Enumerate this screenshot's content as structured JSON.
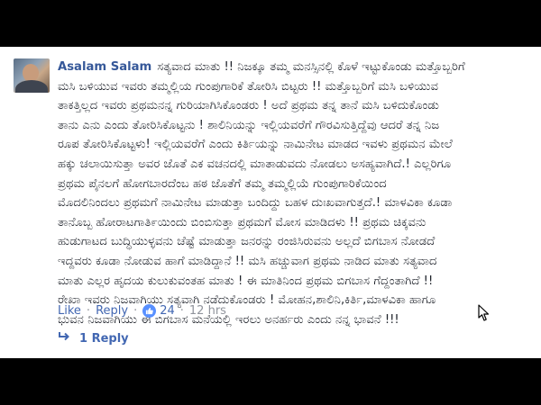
{
  "comment": {
    "author": "Asalam Salam",
    "text": "ಸತ್ಯವಾದ ಮಾತು !! ನಿಜಕ್ಕೂ ತಮ್ಮ ಮನಸ್ಸಿನಲ್ಲಿ ಕೊಳೆ ಇಟ್ಟುಕೊಂಡು ಮತ್ತೊಬ್ಬರಿಗೆ\nಮಸಿ ಬಳಿಯುವ ಇವರು ತಮ್ಮಲ್ಲಿಯ ಗುಂಪುಗಾರಿಕೆ ತೋರಿಸಿ ಬಿಟ್ಟರು !! ಮತ್ತೊಬ್ಬರಿಗೆ ಮಸಿ ಬಳಿಯುವ\nತಾಕತ್ತಿಲ್ಲದ ಇವರು ಪ್ರಥಮನನ್ನ ಗುರಿಯಾಗಿಸಿಕೊಂಡರು ! ಅದೆ ಪ್ರಥಮ ತನ್ನ ತಾನೆ ಮಸಿ ಬಳಿದುಕೊಂಡು\nತಾನು ಎನು ಎಂದು ತೋರಿಸಿಕೊಟ್ಟನು ! ಶಾಲಿನಿಯನ್ನು ಇಲ್ಲಿಯವರೆಗೆ ಗೌರವಿಸುತ್ತಿದ್ದೆವು ಆದರೆ ತನ್ನ ನಿಜ\nರೂಪ ತೋರಿಸಿಕೊಟ್ಟಳು! ಇಲ್ಲಿಯವರೆಗೆ ಎಂದು ಕಿರ್ತಿಯನ್ನು ನಾಮಿನೇಟ ಮಾಡದ ಇವಳು ಪ್ರಥಮನ ಮೇಲೆ\nಹಕ್ಕು ಚಲಾಯಿಸುತ್ತಾ ಅವರ ಜೊತೆ ಎಕ ವಚನದಲ್ಲಿ ಮಾತಾಡುವದು ನೋಡಲು ಅಸಹ್ಯವಾಗಿದೆ.! ಎಲ್ಲರಿಗೂ\nಪ್ರಥಮ ಪೈನಲಗೆ ಹೋಗಬಾರದೆಂಬ ಹಠ ಜೊತೆಗೆ ತಮ್ಮ ತಮ್ಮಲ್ಲಿಯೆ ಗುಂಪುಗಾರಿಕೆಯಿಂದ\nಮೊದಲಿನಿಂದಲು ಪ್ರಥಮಗೆ ನಾಮಿನೇಟ ಮಾಡುತ್ತಾ ಬಂದಿದ್ದು ಬಹಳ ದುಃಖವಾಗುತ್ತದೆ.! ಮಾಳವಿಕಾ ಕೂಡಾ\nತಾನೊಬ್ಬ ಹೋರಾಟಗಾತಿ೯ಯಿಂದು ಬಿಂಬಿಸುತ್ತಾ ಪ್ರಥಮಗೆ ಮೋಸ ಮಾಡಿದಳು !! ಪ್ರಥಮ ಚಿಕ್ಕವನು\nಹುಡುಗಾಟದ ಬುದ್ಧಿಯುಳ್ಳವನು ಚೆಷ್ಟೆ ಮಾಡುತ್ತಾ ಜನರನ್ನು ರಂಜಿಸಿರುವನು ಅಲ್ಲದೆ ಬಿಗಬಾಸ ನೋಡದೆ\nಇದ್ದವರು ಕೂಡಾ ನೋಡುವ ಹಾಗೆ ಮಾಡಿದ್ದಾನೆ !! ಮಸಿ ಹಚ್ಚುವಾಗ ಪ್ರಥಮ ನಾಡಿದ ಮಾತು ಸತ್ಯವಾದ\nಮಾತು ಎಲ್ಲರ ಹೃದಯ ಕುಲುಕುವಂತಹ ಮಾತು ! ಈ ಮಾತಿನಿಂದ ಪ್ರಥಮ ಬಿಗಬಾಸ ಗೆದ್ದಂತಾಗಿದೆ !!\nರೇಖಾ ಇವರು ನಿಜವಾಗಿಯು ಸತ್ಯವಾಗಿ ನಡೆದುಕೊಂಡರು ! ಮೋಹನ,ಶಾಲಿನಿ,ಕಿರ್ತಿ,ಮಾಳವಿಕಾ ಹಾಗೂ\nಭುವನ ನಿಜವಾಗಿಯು ಈ ಬಿಗಬಾಸ ಮನೆಯಲ್ಲಿ ಇರಲು ಅನರ್ಹರು ಎಂದು ನನ್ನ ಭಾವನೆ !!!"
  },
  "meta": {
    "like_label": "Like",
    "separator": "·",
    "reply_label": "Reply",
    "like_count": "24",
    "time": "12 hrs"
  },
  "replies": {
    "label": "1 Reply"
  },
  "colors": {
    "link": "#365899",
    "action": "#4267b2",
    "muted": "#90949c",
    "text": "#1d2129",
    "like_badge": "#5890ff"
  },
  "icons": {
    "like_badge": "thumbs-up-icon",
    "reply_arrow": "reply-arrow-icon",
    "cursor": "mouse-pointer-icon"
  }
}
